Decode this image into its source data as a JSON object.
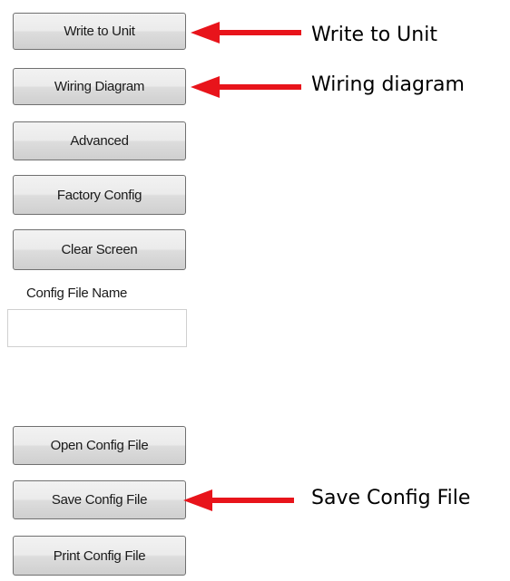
{
  "panel": {
    "write_to_unit_label": "Write to Unit",
    "wiring_diagram_label": "Wiring Diagram",
    "advanced_label": "Advanced",
    "factory_config_label": "Factory Config",
    "clear_screen_label": "Clear Screen",
    "config_file_name_label": "Config File Name",
    "config_file_name_value": "",
    "open_config_file_label": "Open Config File",
    "save_config_file_label": "Save Config File",
    "print_config_file_label": "Print Config File"
  },
  "annotations": {
    "write_to_unit": "Write to Unit",
    "wiring_diagram": "Wiring diagram",
    "save_config_file": "Save Config File",
    "arrow_color": "#e8141b"
  }
}
